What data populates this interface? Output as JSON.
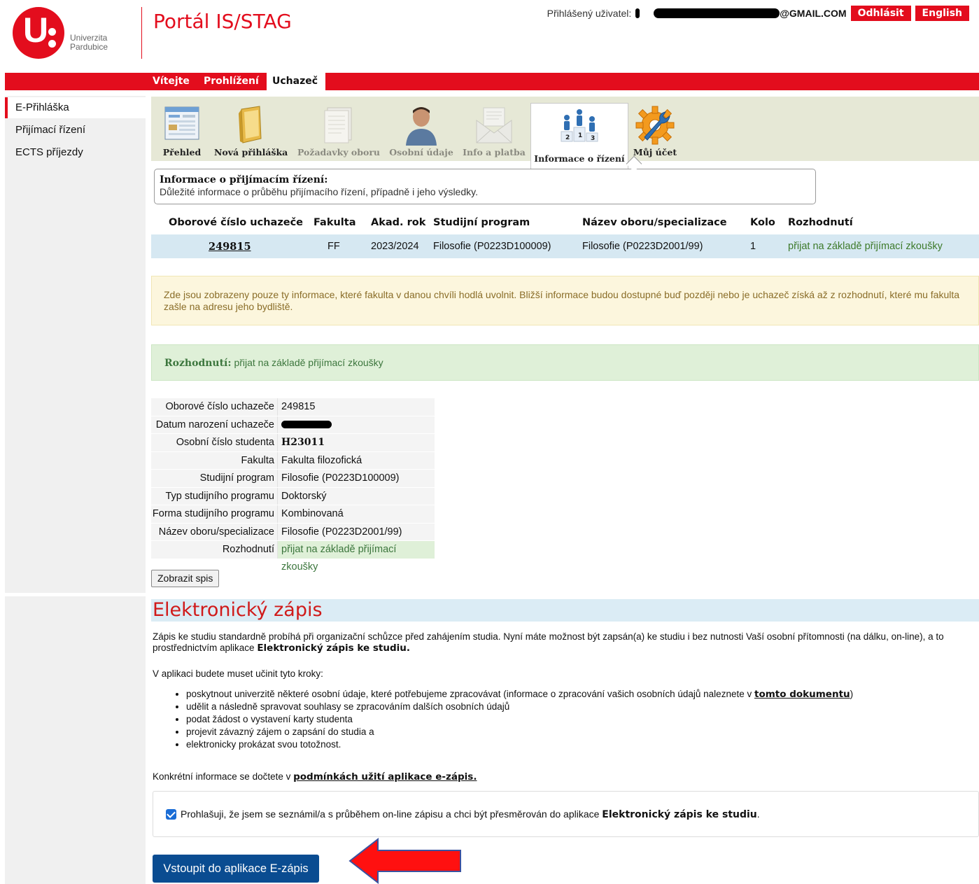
{
  "header": {
    "logo_line1": "Univerzita",
    "logo_line2": "Pardubice",
    "portal_title": "Portál IS/STAG",
    "user_label": "Přihlášený uživatel:",
    "user_email_visible": "@GMAIL.COM",
    "logout": "Odhlásit",
    "language": "English"
  },
  "nav": {
    "tabs": [
      "Vítejte",
      "Prohlížení",
      "Uchazeč"
    ],
    "active": "Uchazeč"
  },
  "sidebar": {
    "items": [
      "E-Přihláška",
      "Přijímací řízení",
      "ECTS příjezdy"
    ]
  },
  "toolbar": {
    "items": [
      {
        "label": "Přehled",
        "icon": "overview-icon"
      },
      {
        "label": "Nová přihláška",
        "icon": "folder-icon"
      },
      {
        "label": "Požadavky oboru",
        "icon": "document-icon"
      },
      {
        "label": "Osobní údaje",
        "icon": "person-icon"
      },
      {
        "label": "Info a platba",
        "icon": "envelope-icon"
      },
      {
        "label": "Informace o řízení",
        "icon": "podium-icon"
      },
      {
        "label": "Můj účet",
        "icon": "gear-wrench-icon"
      }
    ]
  },
  "infobox": {
    "title": "Informace o přijímacím řízení:",
    "subtitle": "Důležité informace o průběhu přijímacího řízení, případně i jeho výsledky."
  },
  "table": {
    "headers": [
      "Oborové číslo uchazeče",
      "Fakulta",
      "Akad. rok",
      "Studijní program",
      "Název oboru/specializace",
      "Kolo",
      "Rozhodnutí"
    ],
    "row": [
      "249815",
      "FF",
      "2023/2024",
      "Filosofie (P0223D100009)",
      "Filosofie (P0223D2001/99)",
      "1",
      "přijat na základě přijímací zkoušky"
    ]
  },
  "warning_text": "Zde jsou zobrazeny pouze ty informace, které fakulta v danou chvíli hodlá uvolnit. Bližší informace budou dostupné buď později nebo je uchazeč získá až z rozhodnutí, které mu fakulta zašle na adresu jeho bydliště.",
  "decision": {
    "label": "Rozhodnutí:",
    "value": "přijat na základě přijímací zkoušky"
  },
  "details": [
    {
      "k": "Oborové číslo uchazeče",
      "v": "249815"
    },
    {
      "k": "Datum narození uchazeče",
      "v": ""
    },
    {
      "k": "Osobní číslo studenta",
      "v": "H23011"
    },
    {
      "k": "Fakulta",
      "v": "Fakulta filozofická"
    },
    {
      "k": "Studijní program",
      "v": "Filosofie (P0223D100009)"
    },
    {
      "k": "Typ studijního programu",
      "v": "Doktorský"
    },
    {
      "k": "Forma studijního programu",
      "v": "Kombinovaná"
    },
    {
      "k": "Název oboru/specializace",
      "v": "Filosofie (P0223D2001/99)"
    },
    {
      "k": "Rozhodnutí",
      "v": "přijat na základě přijímací zkoušky"
    }
  ],
  "show_file_button": "Zobrazit spis",
  "ezapis": {
    "title": "Elektronický zápis",
    "intro_pre": "Zápis ke studiu standardně probíhá při organizační schůzce před zahájením studia. Nyní máte možnost být zapsán(a) ke studiu i bez nutnosti Vaší osobní přítomnosti (na dálku, on-line), a to prostřednictvím aplikace ",
    "intro_bold": "Elektronický zápis ke studiu.",
    "steps_intro": "V aplikaci budete muset učinit tyto kroky:",
    "step1_pre": "poskytnout univerzitě některé osobní údaje, které potřebujeme zpracovávat (informace o zpracování vašich osobních údajů naleznete v ",
    "step1_link": "tomto dokumentu",
    "step1_post": ")",
    "step2": "udělit a následně spravovat souhlasy se zpracováním dalších osobních údajů",
    "step3": "podat žádost o vystavení karty studenta",
    "step4": "projevit závazný zájem o zapsání do studia a",
    "step5": "elektronicky prokázat svou totožnost.",
    "info_pre": "Konkrétní informace se dočtete v ",
    "info_link": "podmínkách užití aplikace e-zápis.",
    "consent_pre": "Prohlašuji, že jsem se seznámil/a s průběhem on-line zápisu a chci být přesměrován do aplikace ",
    "consent_bold": "Elektronický zápis ke studiu",
    "consent_post": ".",
    "enter_button": "Vstoupit do aplikace E-zápis"
  },
  "colors": {
    "brand_red": "#e30d1d",
    "button_blue": "#0a4c91",
    "success_green": "#3c763d"
  }
}
